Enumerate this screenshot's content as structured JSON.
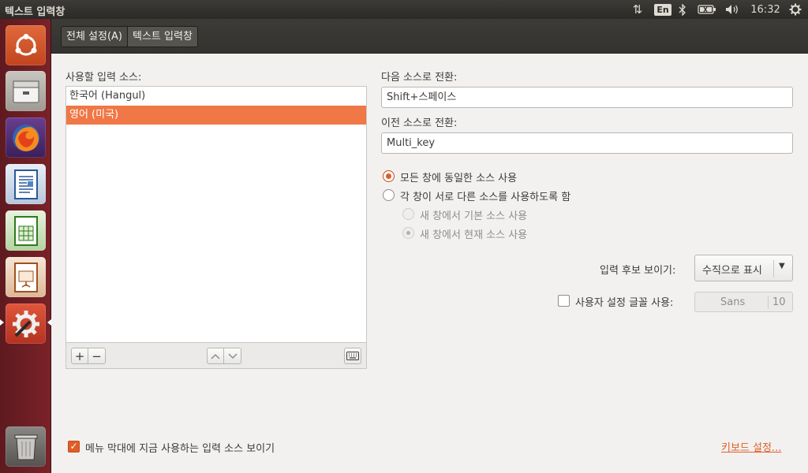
{
  "window": {
    "title": "텍스트 입력창"
  },
  "tray": {
    "network_icon": "⇅",
    "language": "En",
    "bluetooth_icon": "bluetooth",
    "battery_icon": "battery",
    "volume_icon": "volume",
    "clock": "16:32",
    "system_icon": "gear"
  },
  "toolbar": {
    "tabs": [
      {
        "label": "전체 설정(A)"
      },
      {
        "label": "텍스트 입력창"
      }
    ]
  },
  "sources": {
    "label": "사용할 입력 소스:",
    "items": [
      {
        "label": "한국어 (Hangul)",
        "selected": false
      },
      {
        "label": "영어 (미국)",
        "selected": true
      }
    ],
    "add_label": "+",
    "remove_label": "−",
    "up_label": "∧",
    "down_label": "∨"
  },
  "switching": {
    "next_label": "다음 소스로 전환:",
    "next_value": "Shift+스페이스",
    "prev_label": "이전 소스로 전환:",
    "prev_value": "Multi_key"
  },
  "options": {
    "same_source_label": "모든 창에 동일한 소스 사용",
    "different_source_label": "각 창이 서로 다른 소스를 사용하도록 함",
    "new_window_default_label": "새 창에서 기본 소스 사용",
    "new_window_current_label": "새 창에서 현재 소스 사용"
  },
  "candidates": {
    "label": "입력 후보 보이기:",
    "value": "수직으로 표시",
    "arrow": "▼"
  },
  "custom_font": {
    "label": "사용자 설정 글꼴 사용:",
    "font_name": "Sans",
    "font_size": "10",
    "checked": false
  },
  "menu_indicator": {
    "label": "메뉴 막대에 지금 사용하는 입력 소스 보이기",
    "checked": true,
    "check_mark": "✓"
  },
  "keyboard_link": "키보드 설정...",
  "colors": {
    "accent": "#f07746",
    "panel": "#3c3b37",
    "launcher": "#6b1d23"
  }
}
